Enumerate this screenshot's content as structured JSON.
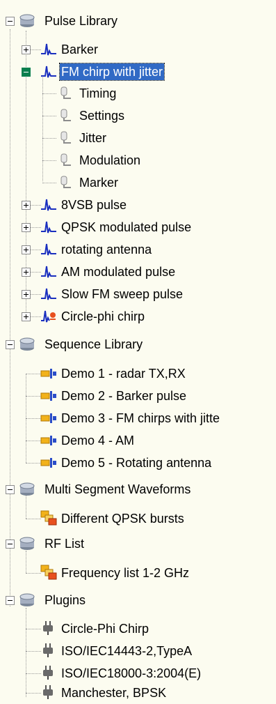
{
  "tree": {
    "pulse_library": {
      "label": "Pulse Library",
      "children": [
        {
          "label": "Barker"
        },
        {
          "label": "FM chirp with jitter",
          "selected": true,
          "children": [
            {
              "label": "Timing"
            },
            {
              "label": "Settings"
            },
            {
              "label": "Jitter"
            },
            {
              "label": "Modulation"
            },
            {
              "label": "Marker"
            }
          ]
        },
        {
          "label": "8VSB pulse"
        },
        {
          "label": "QPSK modulated pulse"
        },
        {
          "label": "rotating antenna"
        },
        {
          "label": "AM modulated pulse"
        },
        {
          "label": "Slow FM sweep pulse"
        },
        {
          "label": "Circle-phi chirp"
        }
      ]
    },
    "sequence_library": {
      "label": "Sequence Library",
      "children": [
        {
          "label": "Demo  1 - radar TX,RX"
        },
        {
          "label": "Demo  2 - Barker pulse"
        },
        {
          "label": "Demo  3 - FM chirps with jitte"
        },
        {
          "label": "Demo  4 - AM"
        },
        {
          "label": "Demo  5 - Rotating antenna"
        }
      ]
    },
    "multi_segment": {
      "label": "Multi Segment Waveforms",
      "children": [
        {
          "label": "Different QPSK bursts"
        }
      ]
    },
    "rf_list": {
      "label": "RF List",
      "children": [
        {
          "label": "Frequency list 1-2 GHz"
        }
      ]
    },
    "plugins": {
      "label": "Plugins",
      "children": [
        {
          "label": "Circle-Phi Chirp"
        },
        {
          "label": "ISO/IEC14443-2,TypeA"
        },
        {
          "label": "ISO/IEC18000-3:2004(E)"
        },
        {
          "label": "Manchester, BPSK"
        }
      ]
    }
  },
  "colors": {
    "background": "#fcfcf0",
    "selection": "#316ac5",
    "pulse_icon": "#1a2fbf",
    "db_icon": "#8a96a8"
  }
}
